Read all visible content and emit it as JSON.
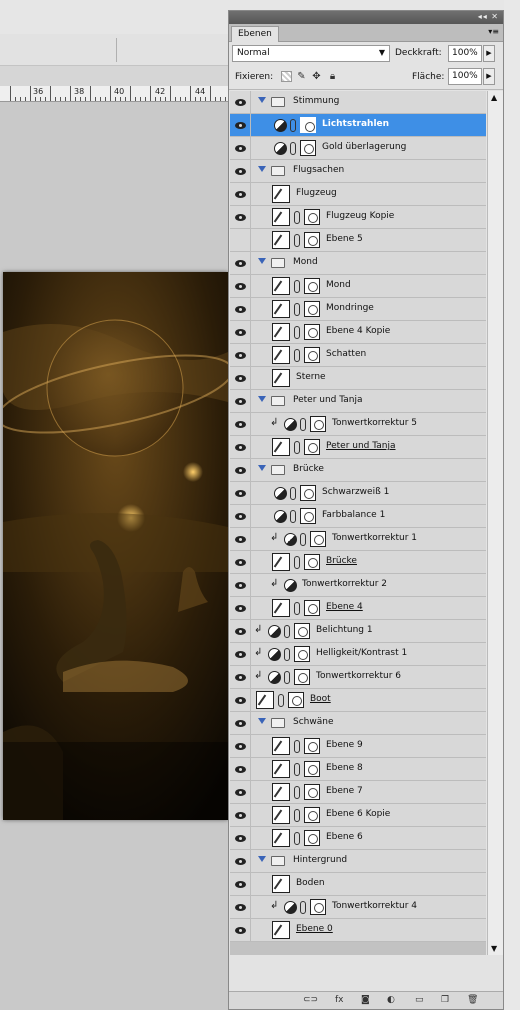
{
  "ruler": {
    "ticks": [
      "36",
      "38",
      "40",
      "42",
      "44"
    ]
  },
  "panel": {
    "tab": "Ebenen",
    "blend_mode": "Normal",
    "opacity_label": "Deckkraft:",
    "opacity": "100%",
    "lock_label": "Fixieren:",
    "fill_label": "Fläche:",
    "fill": "100%"
  },
  "layers": [
    {
      "name": "Stimmung",
      "type": "group",
      "visible": true
    },
    {
      "name": "Lichtstrahlen",
      "type": "adj",
      "indent": 1,
      "selected": true,
      "bold": true,
      "visible": true
    },
    {
      "name": "Gold überlagerung",
      "type": "adj",
      "indent": 1,
      "visible": true
    },
    {
      "name": "Flugsachen",
      "type": "group",
      "visible": true
    },
    {
      "name": "Flugzeug",
      "type": "pixel",
      "indent": 1,
      "visible": true
    },
    {
      "name": "Flugzeug Kopie",
      "type": "pixelmask",
      "indent": 1,
      "visible": true
    },
    {
      "name": "Ebene 5",
      "type": "pixelmask",
      "indent": 1,
      "visible": false
    },
    {
      "name": "Mond",
      "type": "group",
      "visible": true
    },
    {
      "name": "Mond",
      "type": "pixelmask",
      "indent": 1,
      "visible": true
    },
    {
      "name": "Mondringe",
      "type": "pixelmask",
      "indent": 1,
      "visible": true
    },
    {
      "name": "Ebene 4 Kopie",
      "type": "pixelmask",
      "indent": 1,
      "visible": true
    },
    {
      "name": "Schatten",
      "type": "pixelmask",
      "indent": 1,
      "visible": true
    },
    {
      "name": "Sterne",
      "type": "pixel",
      "indent": 1,
      "visible": true
    },
    {
      "name": "Peter und Tanja",
      "type": "group",
      "visible": true
    },
    {
      "name": "Tonwertkorrektur 5",
      "type": "adj",
      "indent": 1,
      "clip": true,
      "visible": true
    },
    {
      "name": "Peter und Tanja",
      "type": "pixelmask",
      "indent": 1,
      "underline": true,
      "visible": true
    },
    {
      "name": "Brücke",
      "type": "group",
      "visible": true
    },
    {
      "name": "Schwarzweiß 1",
      "type": "adj",
      "indent": 1,
      "visible": true
    },
    {
      "name": "Farbbalance 1",
      "type": "adj",
      "indent": 1,
      "visible": true
    },
    {
      "name": "Tonwertkorrektur 1",
      "type": "adj",
      "indent": 1,
      "clip": true,
      "visible": true
    },
    {
      "name": "Brücke",
      "type": "pixelmask",
      "indent": 1,
      "underline": true,
      "visible": true
    },
    {
      "name": "Tonwertkorrektur 2",
      "type": "adjnomask",
      "indent": 1,
      "clip": true,
      "visible": true
    },
    {
      "name": "Ebene 4",
      "type": "pixelmask",
      "indent": 1,
      "underline": true,
      "visible": true
    },
    {
      "name": "Belichtung 1",
      "type": "adj",
      "indent": 0,
      "clip": true,
      "visible": true
    },
    {
      "name": "Helligkeit/Kontrast 1",
      "type": "adj",
      "indent": 0,
      "clip": true,
      "visible": true
    },
    {
      "name": "Tonwertkorrektur 6",
      "type": "adj",
      "indent": 0,
      "clip": true,
      "visible": true
    },
    {
      "name": "Boot",
      "type": "pixelmask",
      "indent": 0,
      "underline": true,
      "visible": true
    },
    {
      "name": "Schwäne",
      "type": "group",
      "visible": true
    },
    {
      "name": "Ebene 9",
      "type": "pixelmask",
      "indent": 1,
      "visible": true
    },
    {
      "name": "Ebene 8",
      "type": "pixelmask",
      "indent": 1,
      "visible": true
    },
    {
      "name": "Ebene 7",
      "type": "pixelmask",
      "indent": 1,
      "visible": true
    },
    {
      "name": "Ebene 6 Kopie",
      "type": "pixelmask",
      "indent": 1,
      "visible": true
    },
    {
      "name": "Ebene 6",
      "type": "pixelmask",
      "indent": 1,
      "visible": true
    },
    {
      "name": "Hintergrund",
      "type": "group",
      "visible": true
    },
    {
      "name": "Boden",
      "type": "pixel",
      "indent": 1,
      "visible": true
    },
    {
      "name": "Tonwertkorrektur 4",
      "type": "adj",
      "indent": 1,
      "clip": true,
      "visible": true
    },
    {
      "name": "Ebene 0",
      "type": "pixel",
      "indent": 1,
      "underline": true,
      "visible": true
    }
  ],
  "bottom_icons": [
    "link-icon",
    "fx-icon",
    "mask-icon",
    "adjustment-icon",
    "folder-icon",
    "new-layer-icon",
    "trash-icon"
  ]
}
